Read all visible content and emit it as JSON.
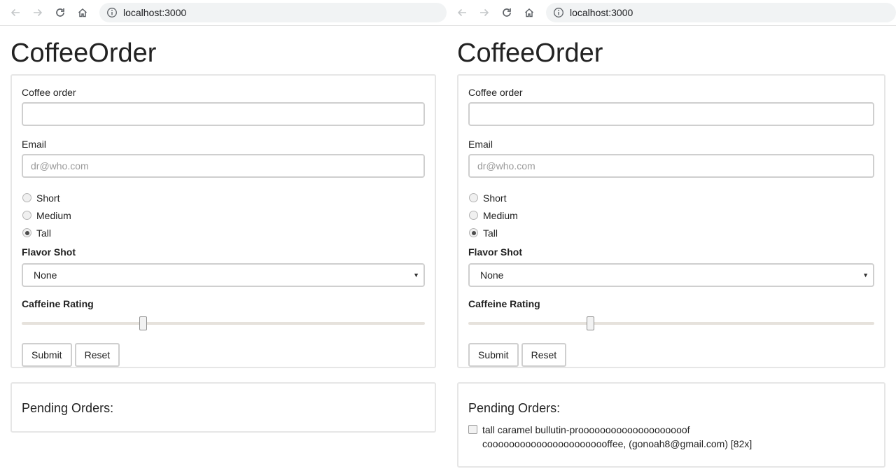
{
  "browser": {
    "url": "localhost:3000"
  },
  "app": {
    "title": "CoffeeOrder"
  },
  "form": {
    "coffee_label": "Coffee order",
    "coffee_value": "",
    "email_label": "Email",
    "email_placeholder": "dr@who.com",
    "sizes": [
      {
        "label": "Short",
        "checked": false
      },
      {
        "label": "Medium",
        "checked": false
      },
      {
        "label": "Tall",
        "checked": true
      }
    ],
    "flavor_label": "Flavor Shot",
    "flavor_selected": "None",
    "caffeine_label": "Caffeine Rating",
    "caffeine_fraction": 0.3,
    "submit_label": "Submit",
    "reset_label": "Reset"
  },
  "orders": {
    "title": "Pending Orders:",
    "left_items": [],
    "right_items": [
      {
        "text": "tall caramel bullutin-proooooooooooooooooooof cooooooooooooooooooooooffee, (gonoah8@gmail.com) [82x]",
        "checked": false
      }
    ]
  },
  "colors": {
    "border": "#e6e6e6",
    "input_border": "#cfcfcf",
    "address_bg": "#f1f3f4"
  }
}
